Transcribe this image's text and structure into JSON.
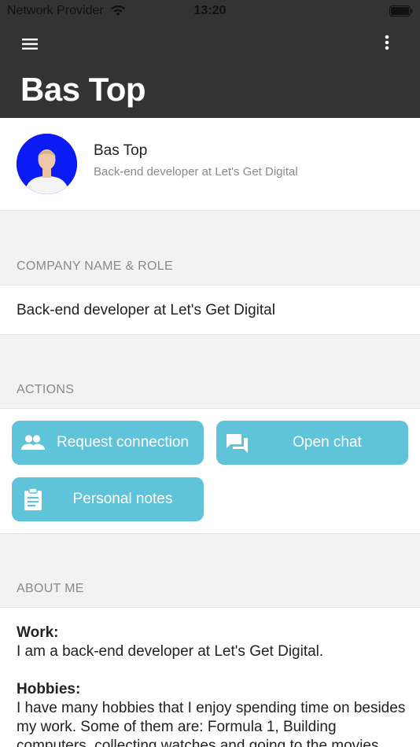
{
  "status_bar": {
    "provider": "Network Provider",
    "time": "13:20",
    "wifi_icon": "wifi-icon",
    "battery_icon": "battery-icon"
  },
  "header": {
    "title": "Bas Top",
    "menu_icon": "hamburger-menu-icon",
    "more_icon": "more-vertical-icon",
    "background": "#333333"
  },
  "profile": {
    "name": "Bas Top",
    "role": "Back-end developer at Let's Get Digital",
    "avatar_background": "#0a1bf5"
  },
  "company_section": {
    "header": "COMPANY NAME & ROLE",
    "value": "Back-end developer at Let's Get Digital"
  },
  "actions_section": {
    "header": "ACTIONS",
    "button_color": "#5fc3d9",
    "buttons": [
      {
        "label": "Request connection",
        "icon": "people-icon"
      },
      {
        "label": "Open chat",
        "icon": "chat-icon"
      },
      {
        "label": "Personal notes",
        "icon": "clipboard-icon"
      }
    ]
  },
  "about_section": {
    "header": "ABOUT ME",
    "work_heading": "Work:",
    "work_text": "I am a back-end developer at Let's Get Digital.",
    "hobbies_heading": "Hobbies:",
    "hobbies_text": "I have many hobbies that I enjoy spending time on besides my work. Some of them are: Formula 1, Building computers, collecting watches and going to the movies."
  }
}
